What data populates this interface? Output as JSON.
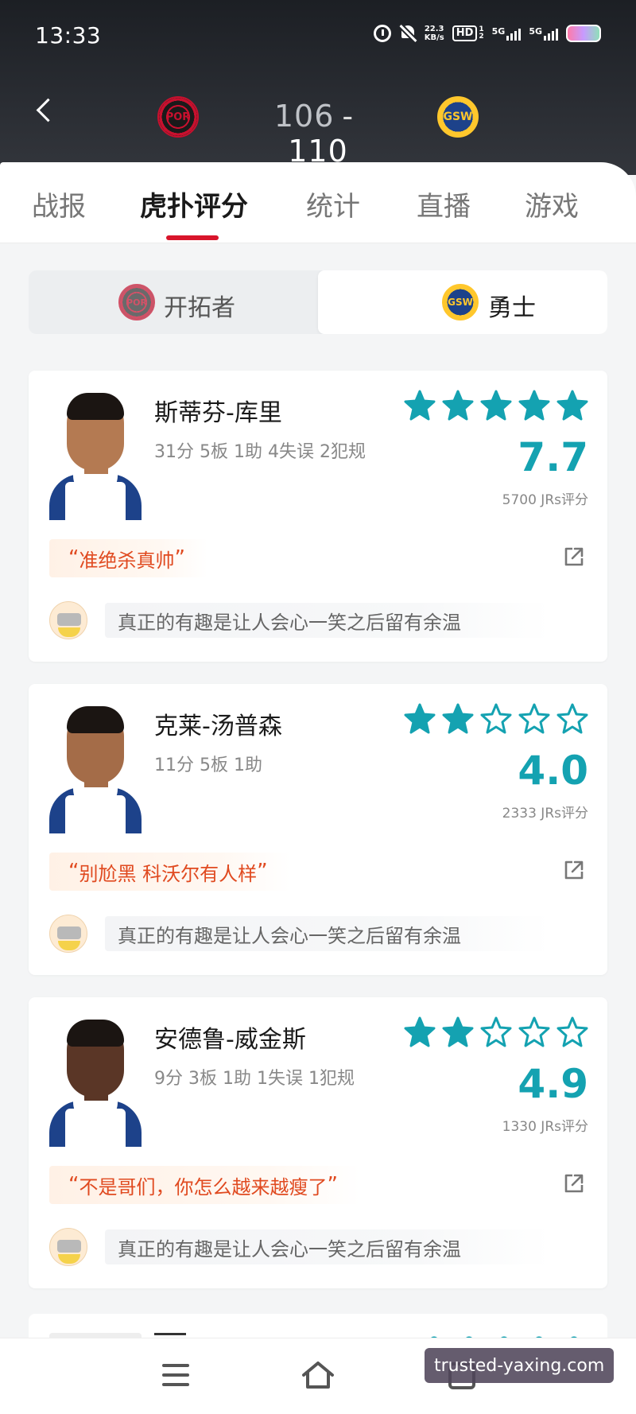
{
  "status_bar": {
    "time": "13:33",
    "net_speed_value": "22.3",
    "net_speed_unit": "KB/s",
    "hd_label": "HD",
    "hd_sub_1": "1",
    "hd_sub_2": "2",
    "sig1_label": "5G",
    "sig2_label": "5G"
  },
  "header": {
    "home_team_abbr": "POR",
    "away_team_abbr": "GSW",
    "home_score": "106",
    "separator": "-",
    "away_score": "110"
  },
  "tabs": [
    {
      "label": "战报",
      "active": false
    },
    {
      "label": "虎扑评分",
      "active": true
    },
    {
      "label": "统计",
      "active": false
    },
    {
      "label": "直播",
      "active": false
    },
    {
      "label": "游戏",
      "active": false
    }
  ],
  "team_toggle": {
    "left": {
      "label": "开拓者",
      "abbr": "POR"
    },
    "right": {
      "label": "勇士",
      "abbr": "GSW",
      "selected": true
    }
  },
  "colors": {
    "accent_teal": "#14a2b1",
    "tab_indicator_red": "#d8152b",
    "quote_orange": "#e04a20"
  },
  "players": [
    {
      "name": "斯蒂芬-库里",
      "stats": "31分 5板 1助 4失误 2犯规",
      "stars_filled": 5,
      "score": "7.7",
      "count": "5700 JRs评分",
      "quote": "准绝杀真帅",
      "comment": "真正的有趣是让人会心一笑之后留有余温",
      "skin": "#b47a52"
    },
    {
      "name": "克莱-汤普森",
      "stats": "11分 5板 1助",
      "stars_filled": 2,
      "score": "4.0",
      "count": "2333 JRs评分",
      "quote": "别尬黑 科沃尔有人样",
      "comment": "真正的有趣是让人会心一笑之后留有余温",
      "skin": "#a46c48"
    },
    {
      "name": "安德鲁-威金斯",
      "stats": "9分 3板 1助 1失误 1犯规",
      "stars_filled": 2,
      "score": "4.9",
      "count": "1330 JRs评分",
      "quote": "不是哥们，你怎么越来越瘦了",
      "comment": "真正的有趣是让人会心一笑之后留有余温",
      "skin": "#5a3626"
    }
  ],
  "quote_open": "“",
  "quote_close": "”",
  "watermark": "trusted-yaxing.com"
}
